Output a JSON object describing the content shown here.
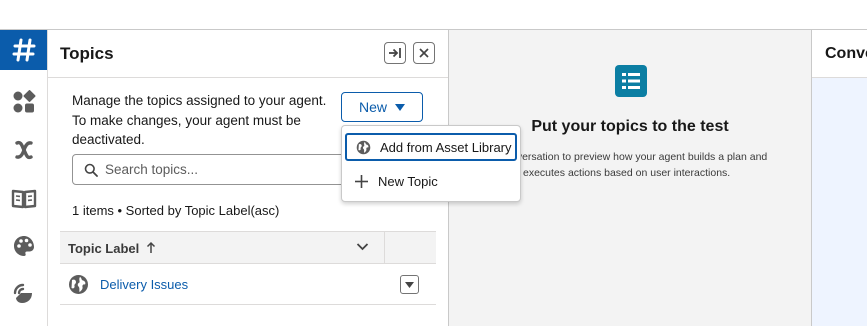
{
  "rail": {
    "items": [
      {
        "icon": "topics-hash-icon",
        "active": true
      },
      {
        "icon": "apps-grid-icon"
      },
      {
        "icon": "variable-x-icon"
      },
      {
        "icon": "book-icon"
      },
      {
        "icon": "palette-icon"
      },
      {
        "icon": "signal-icon"
      }
    ]
  },
  "topics_panel": {
    "title": "Topics",
    "description": "Manage the topics assigned to your agent. To make changes, your agent must be deactivated.",
    "new_label": "New",
    "search": {
      "placeholder": "Search topics...",
      "value": ""
    },
    "meta": "1 items • Sorted by Topic Label(asc)",
    "table": {
      "column_label": "Topic Label",
      "sort_direction": "asc",
      "rows": [
        {
          "label": "Delivery Issues"
        }
      ]
    }
  },
  "new_menu": {
    "items": [
      {
        "label": "Add from Asset Library",
        "icon": "globe-icon",
        "focused": true
      },
      {
        "label": "New Topic",
        "icon": "plus-icon",
        "focused": false
      }
    ]
  },
  "center": {
    "title": "Put your topics to the test",
    "body_line1": "nversation to preview how your agent builds a plan and",
    "body_line2": "executes actions based on user interactions."
  },
  "right_panel": {
    "title": "Conve"
  },
  "colors": {
    "accent": "#0b5cab",
    "center_icon": "#0b7ea3",
    "center_bg": "#f3f3f3",
    "right_bg": "#eef4ff"
  }
}
